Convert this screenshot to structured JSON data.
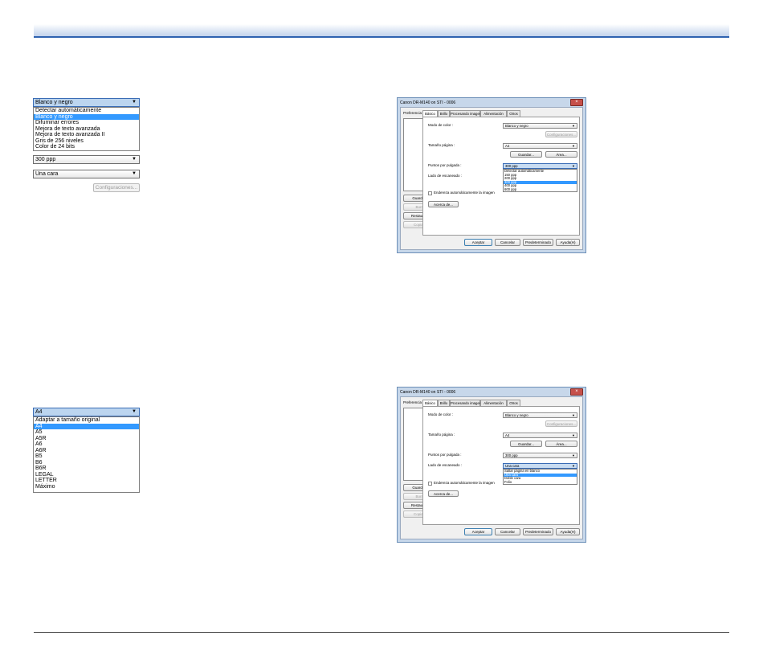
{
  "colors": {
    "accent": "#2e62b0",
    "selection": "#3399ff",
    "close_button": "#c6504a"
  },
  "color_mode_widget": {
    "selected": "Blanco y negro",
    "options": [
      "Detectar automáticamente",
      "Blanco y negro",
      "Difuminar errores",
      "Mejora de texto avanzada",
      "Mejora de texto avanzada II",
      "Gris de 256 niveles",
      "Color de 24 bits"
    ],
    "highlighted_index": 1,
    "resolution_value": "300 ppp",
    "side_value": "Una cara",
    "settings_button": "Configuraciones..."
  },
  "page_size_widget": {
    "selected": "A4",
    "options": [
      "Adaptar a tamaño original",
      "A4",
      "A5",
      "A5R",
      "A6",
      "A6R",
      "B5",
      "B6",
      "B6R",
      "LEGAL",
      "LETTER",
      "Máximo"
    ],
    "highlighted_index": 1
  },
  "dialog": {
    "title": "Canon DR-M140 on STI - 0006",
    "close_icon": "×",
    "pref_label": "Preferencia del usuario :",
    "save_button": "Guardar(V)...",
    "delete_button": "Borrar(L)",
    "restore_button": "Restaurar(F)...",
    "copy_button": "Copiar(E)...",
    "tabs": [
      "Básico",
      "Brillo",
      "Procesando imagen",
      "Alimentación",
      "Otros"
    ],
    "color_mode_label": "Modo de color :",
    "color_mode_value": "Blanco y negro",
    "config_button": "Configuraciones...",
    "page_size_label": "Tamaño página :",
    "page_size_value": "A4",
    "register_button": "Guardar...",
    "area_button": "Área...",
    "dpi_label": "Puntos por pulgada :",
    "dpi_value": "300 ppp",
    "side_label": "Lado de escaneado :",
    "side_value": "Una cara",
    "straighten_label": "Endereza automáticamente la imagen",
    "about_button": "Acerca de...",
    "ok_button": "Aceptar",
    "cancel_button": "Cancelar",
    "default_button": "Predeterminado",
    "help_button": "Ayuda(H)"
  },
  "dialog_dpi_list": {
    "options": [
      "Detectar automáticamente",
      "150 ppp",
      "200 ppp",
      "300 ppp",
      "400 ppp",
      "600 ppp"
    ],
    "highlighted_index": 3
  },
  "dialog_side_list": {
    "options": [
      "Saltar página en blanco",
      "Una cara",
      "Doble cara",
      "Folio"
    ],
    "highlighted_index": 1
  }
}
